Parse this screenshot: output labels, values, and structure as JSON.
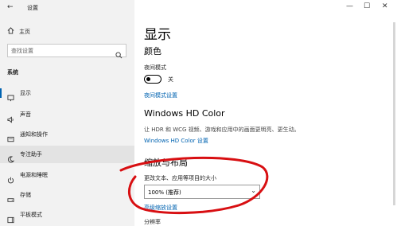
{
  "window": {
    "back_glyph": "←",
    "title": "设置",
    "minimize_glyph": "—",
    "maximize_glyph": "☐",
    "close_glyph": "✕"
  },
  "sidebar": {
    "home_label": "主页",
    "search_placeholder": "查找设置",
    "section_label": "系统",
    "items": [
      {
        "label": "显示",
        "icon": "monitor-icon"
      },
      {
        "label": "声音",
        "icon": "speaker-icon"
      },
      {
        "label": "通知和操作",
        "icon": "notification-icon"
      },
      {
        "label": "专注助手",
        "icon": "moon-icon"
      },
      {
        "label": "电源和睡眠",
        "icon": "power-icon"
      },
      {
        "label": "存储",
        "icon": "storage-icon"
      },
      {
        "label": "平板模式",
        "icon": "tablet-icon"
      }
    ]
  },
  "main": {
    "title": "显示",
    "color_heading": "颜色",
    "night_light_label": "夜间模式",
    "night_light_state": "关",
    "night_light_link": "夜间模式设置",
    "hd_heading": "Windows HD Color",
    "hd_desc": "让 HDR 和 WCG 视频、游戏和应用中的画面更明亮、更生动。",
    "hd_link": "Windows HD Color 设置",
    "scale_heading": "缩放与布局",
    "scale_label": "更改文本、应用等项目的大小",
    "scale_value": "100% (推荐)",
    "scale_link": "高级缩放设置",
    "resolution_label": "分辨率"
  },
  "colors": {
    "accent": "#0063b1",
    "annotation": "#d80f12"
  }
}
